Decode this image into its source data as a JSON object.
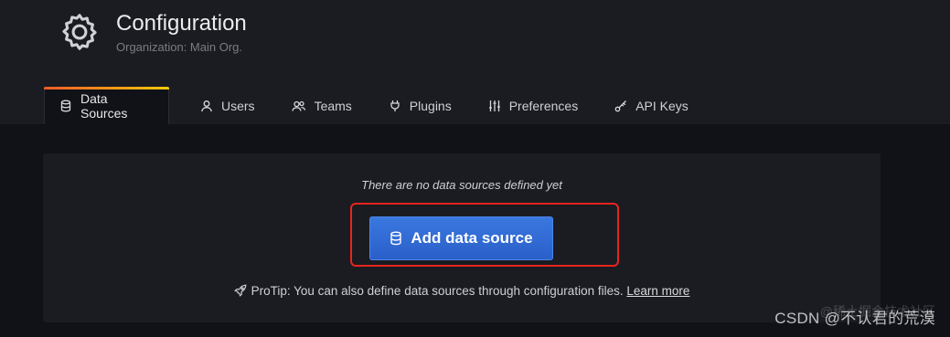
{
  "header": {
    "icon": "gear-icon",
    "title": "Configuration",
    "subtitle": "Organization: Main Org."
  },
  "tabs": [
    {
      "label": "Data Sources",
      "icon": "database-icon",
      "active": true
    },
    {
      "label": "Users",
      "icon": "user-icon",
      "active": false
    },
    {
      "label": "Teams",
      "icon": "users-icon",
      "active": false
    },
    {
      "label": "Plugins",
      "icon": "plug-icon",
      "active": false
    },
    {
      "label": "Preferences",
      "icon": "sliders-icon",
      "active": false
    },
    {
      "label": "API Keys",
      "icon": "key-icon",
      "active": false
    }
  ],
  "empty_state": {
    "message": "There are no data sources defined yet",
    "button_label": "Add data source",
    "button_icon": "database-icon",
    "protip_prefix": "ProTip: You can also define data sources through configuration files.",
    "protip_icon": "rocket-icon",
    "learn_more": "Learn more"
  },
  "watermark": {
    "text": "CSDN @不认君的荒漠",
    "faint_text": "@稀土掘金技术社区"
  },
  "colors": {
    "background": "#111217",
    "panel": "#1b1c21",
    "primary_button": "#3274d9",
    "highlight_border": "#e8241f",
    "active_tab_accent": "#f05a28"
  }
}
